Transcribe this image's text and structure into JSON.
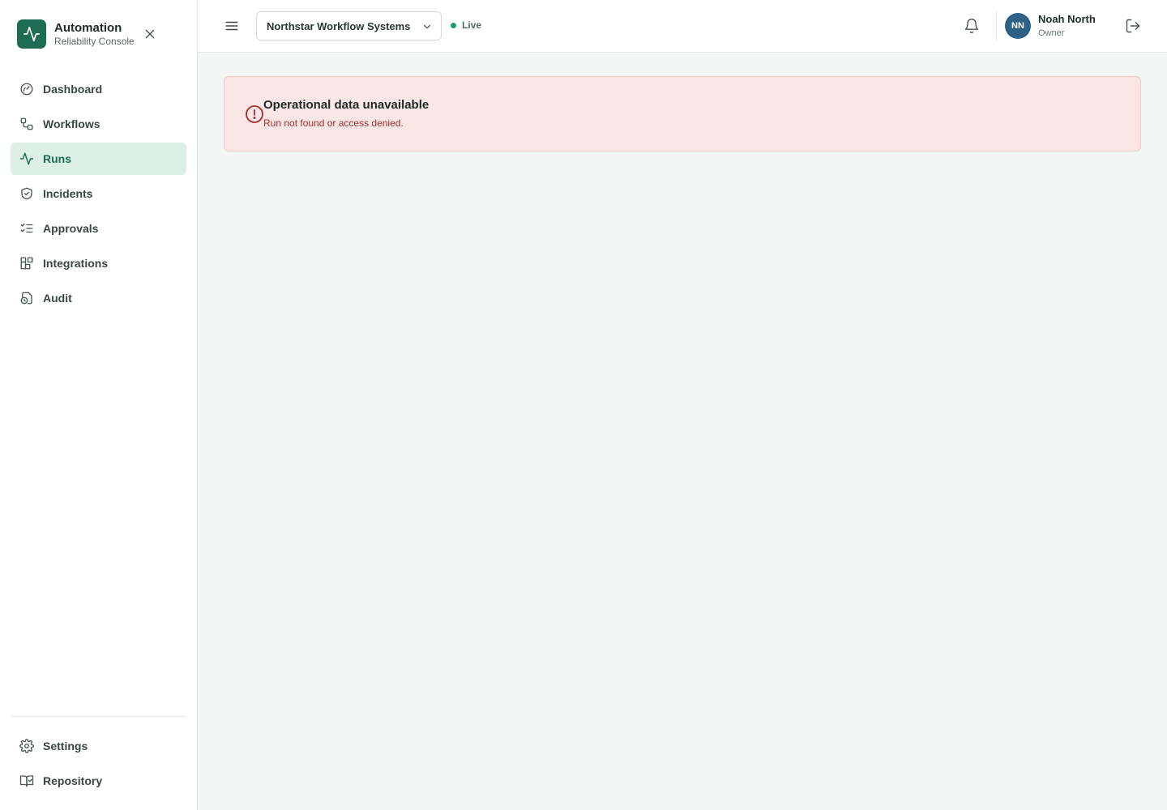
{
  "brand": {
    "title": "Automation",
    "subtitle": "Reliability Console",
    "logo_icon": "activity-icon",
    "accent": "#1d6b52"
  },
  "sidebar": {
    "items": [
      {
        "label": "Dashboard",
        "icon": "gauge-icon",
        "active": false
      },
      {
        "label": "Workflows",
        "icon": "workflow-icon",
        "active": false
      },
      {
        "label": "Runs",
        "icon": "activity-icon",
        "active": true
      },
      {
        "label": "Incidents",
        "icon": "shield-check-icon",
        "active": false
      },
      {
        "label": "Approvals",
        "icon": "list-checks-icon",
        "active": false
      },
      {
        "label": "Integrations",
        "icon": "blocks-icon",
        "active": false
      },
      {
        "label": "Audit",
        "icon": "file-clock-icon",
        "active": false
      }
    ],
    "bottom_items": [
      {
        "label": "Settings",
        "icon": "gear-icon"
      },
      {
        "label": "Repository",
        "icon": "book-check-icon"
      }
    ]
  },
  "header": {
    "organization": "Northstar Workflow Systems",
    "status_label": "Live",
    "status_color": "#1e9e68",
    "user": {
      "initials": "NN",
      "name": "Noah North",
      "role": "Owner",
      "avatar_color": "#2e5f85"
    }
  },
  "main": {
    "alert": {
      "title": "Operational data unavailable",
      "message": "Run not found or access denied.",
      "icon": "alert-circle-icon",
      "color": "#a3302a"
    }
  }
}
